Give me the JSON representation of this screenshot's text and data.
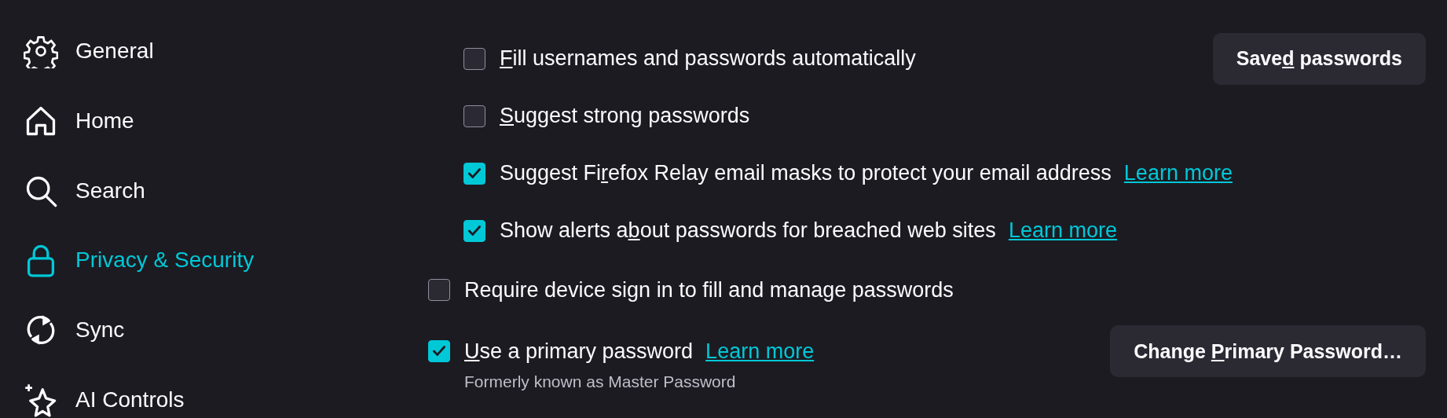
{
  "sidebar": {
    "items": [
      {
        "label": "General",
        "selected": false
      },
      {
        "label": "Home",
        "selected": false
      },
      {
        "label": "Search",
        "selected": false
      },
      {
        "label": "Privacy & Security",
        "selected": true
      },
      {
        "label": "Sync",
        "selected": false
      },
      {
        "label": "AI Controls",
        "selected": false
      }
    ]
  },
  "nested_options": [
    {
      "label": {
        "key": "F",
        "after": "ill usernames and passwords automatically"
      },
      "checked": false,
      "button": {
        "label": {
          "before": "Save",
          "key": "d",
          "after": " passwords"
        }
      }
    },
    {
      "label": {
        "key": "S",
        "after": "uggest strong passwords"
      },
      "checked": false
    },
    {
      "label": {
        "before": "Suggest Fi",
        "key": "r",
        "after": "efox Relay email masks to protect your email address"
      },
      "checked": true,
      "link": "Learn more"
    },
    {
      "label": {
        "before": "Show alerts a",
        "key": "b",
        "after": "out passwords for breached web sites"
      },
      "checked": true,
      "link": "Learn more"
    }
  ],
  "options": [
    {
      "label": {
        "before": "Require device sign in to fill and manage passwords"
      },
      "checked": false
    },
    {
      "label": {
        "key": "U",
        "after": "se a primary password"
      },
      "checked": true,
      "link": "Learn more",
      "button": {
        "label": {
          "before": "Change ",
          "key": "P",
          "after": "rimary Password…"
        }
      },
      "note": "Formerly known as Master Password"
    }
  ]
}
